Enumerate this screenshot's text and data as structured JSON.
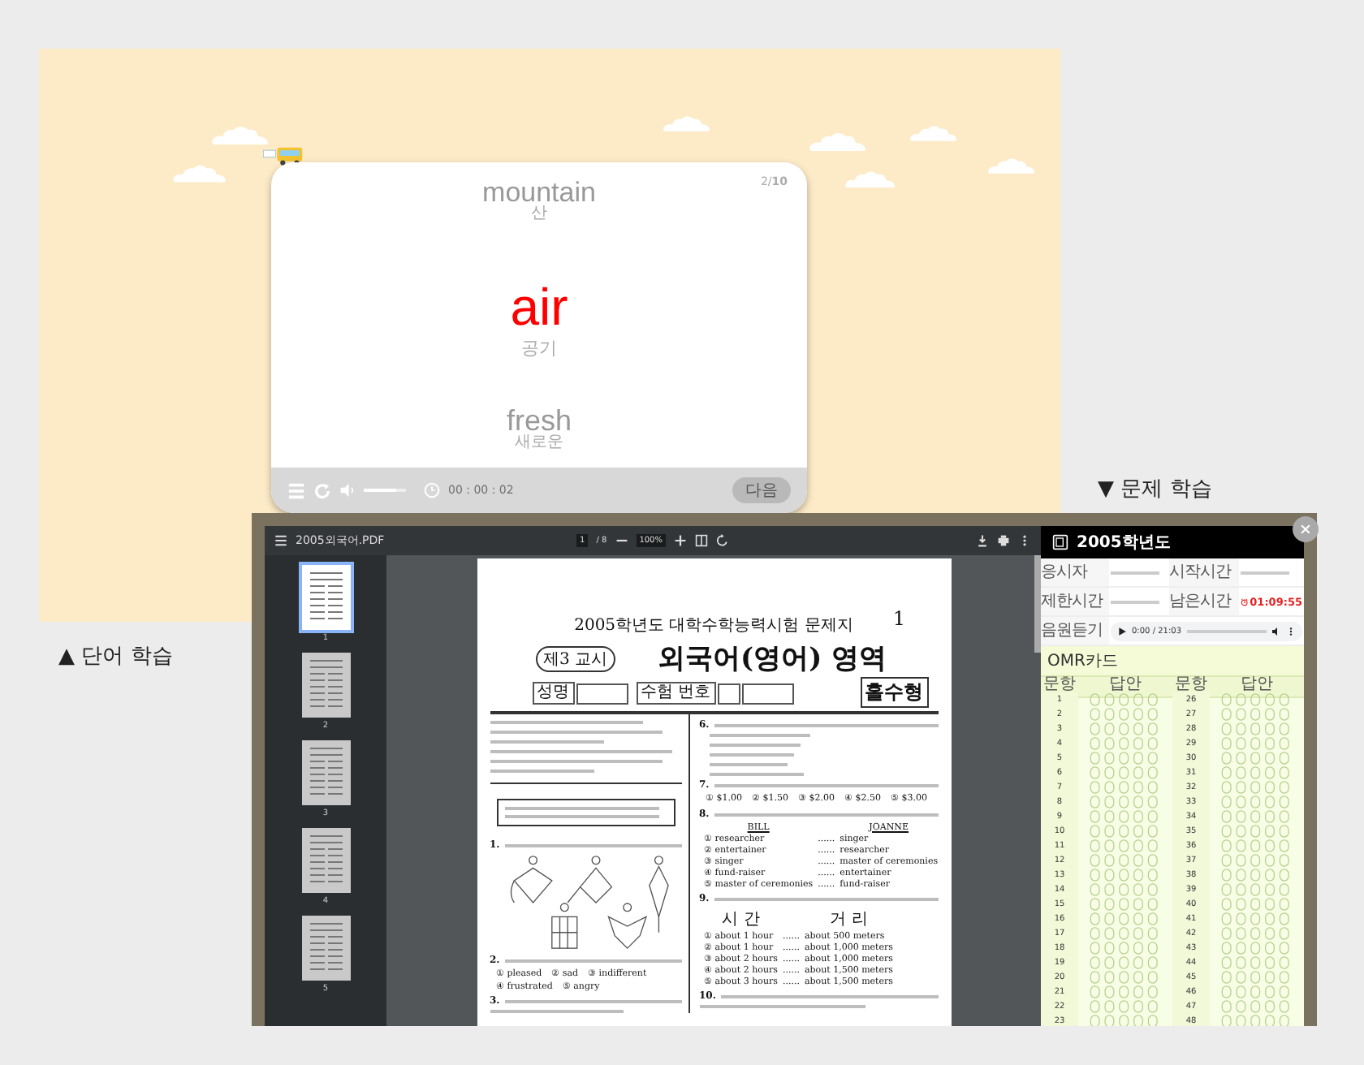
{
  "flashcard": {
    "counter": "2/**10**",
    "words": [
      {
        "kind": "previous",
        "word": "mountain",
        "meaning": "산"
      },
      {
        "kind": "current",
        "word": "air",
        "meaning": "공기"
      },
      {
        "kind": "next",
        "word": "fresh",
        "meaning": "새로운"
      }
    ],
    "volume": {
      "level": 0.75
    },
    "timer": "00 : 00 : 02",
    "next_button": {
      "label": "다음",
      "disabled": true
    }
  },
  "word_label": "▲ 단어 학습",
  "quiz_label": "▼ 문제 학습",
  "pdf_viewer": {
    "filename": "2005외국어.PDF",
    "page_current": "1",
    "page_total": "/ 8",
    "zoom": "100%",
    "thumbnails": [
      {
        "label": "1",
        "selected": true
      },
      {
        "label": "2",
        "selected": false
      },
      {
        "label": "3",
        "selected": false
      },
      {
        "label": "4",
        "selected": false
      },
      {
        "label": "5",
        "selected": false
      }
    ],
    "page": {
      "subtitle": "2005학년도 대학수학능력시험 문제지",
      "page_number": "1",
      "period": "제3 교시",
      "title": "외국어(영어) 영역",
      "name_label": "성명",
      "id_label": "수험 번호",
      "form_type": "홀수형",
      "left_questions": [
        {
          "number": "1.",
          "kind": "kites"
        },
        {
          "number": "2.",
          "kind": "options",
          "options": [
            "① pleased",
            "② sad",
            "③ indifferent",
            "④ frustrated",
            "⑤ angry"
          ]
        },
        {
          "number": "3.",
          "kind": "text"
        }
      ],
      "right_questions": [
        {
          "number": "6.",
          "kind": "list"
        },
        {
          "number": "7.",
          "kind": "options",
          "options": [
            "① $1.00",
            "② $1.50",
            "③ $2.00",
            "④ $2.50",
            "⑤ $3.00"
          ]
        },
        {
          "number": "8.",
          "kind": "table",
          "separator": "......",
          "headers": [
            "BILL",
            "JOANNE"
          ],
          "rows": [
            [
              "① researcher",
              "singer"
            ],
            [
              "② entertainer",
              "researcher"
            ],
            [
              "③ singer",
              "master of ceremonies"
            ],
            [
              "④ fund-raiser",
              "entertainer"
            ],
            [
              "⑤ master of ceremonies",
              "fund-raiser"
            ]
          ]
        },
        {
          "number": "9.",
          "kind": "table",
          "separator": "......",
          "headers": [
            "시 간",
            "거 리"
          ],
          "rows": [
            [
              "① about 1 hour",
              "about 500 meters"
            ],
            [
              "② about 1 hour",
              "about 1,000 meters"
            ],
            [
              "③ about 2 hours",
              "about 1,000 meters"
            ],
            [
              "④ about 2 hours",
              "about 1,500 meters"
            ],
            [
              "⑤ about 3 hours",
              "about 1,500 meters"
            ]
          ]
        },
        {
          "number": "10.",
          "kind": "text"
        }
      ]
    }
  },
  "quiz": {
    "title": "2005학년도",
    "info": [
      {
        "label": "응시자",
        "kind": "blurred"
      },
      {
        "label": "시작시간",
        "kind": "blurred"
      },
      {
        "label": "제한시간",
        "kind": "blurred"
      },
      {
        "label": "남은시간",
        "kind": "timer",
        "value": "01:09:55"
      }
    ],
    "audio": {
      "label": "음원듣기",
      "time": "0:00 / 21:03"
    },
    "omr": {
      "title": "OMR카드",
      "headers": [
        "문항",
        "답안",
        "문항",
        "답안"
      ],
      "rows": [
        [
          "1",
          "26"
        ],
        [
          "2",
          "27"
        ],
        [
          "3",
          "28"
        ],
        [
          "4",
          "29"
        ],
        [
          "5",
          "30"
        ],
        [
          "6",
          "31"
        ],
        [
          "7",
          "32"
        ],
        [
          "8",
          "33"
        ],
        [
          "9",
          "34"
        ],
        [
          "10",
          "35"
        ],
        [
          "11",
          "36"
        ],
        [
          "12",
          "37"
        ],
        [
          "13",
          "38"
        ],
        [
          "14",
          "39"
        ],
        [
          "15",
          "40"
        ],
        [
          "16",
          "41"
        ],
        [
          "17",
          "42"
        ],
        [
          "18",
          "43"
        ],
        [
          "19",
          "44"
        ],
        [
          "20",
          "45"
        ],
        [
          "21",
          "46"
        ],
        [
          "22",
          "47"
        ],
        [
          "23",
          "48"
        ]
      ]
    }
  }
}
